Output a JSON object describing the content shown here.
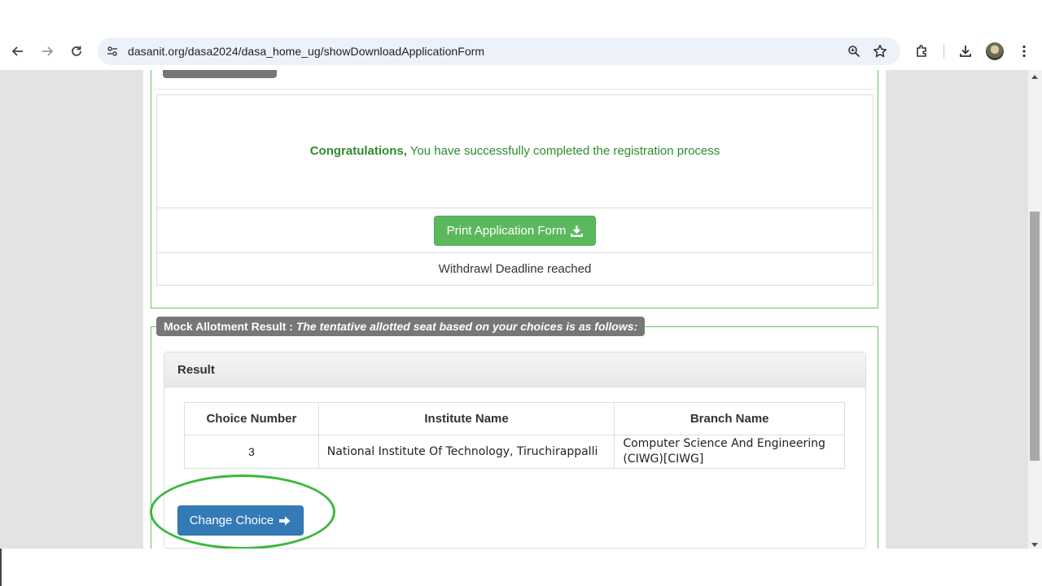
{
  "browser": {
    "url": "dasanit.org/dasa2024/dasa_home_ug/showDownloadApplicationForm",
    "icons": [
      "back-arrow-icon",
      "forward-arrow-icon",
      "reload-icon",
      "site-settings-icon",
      "zoom-icon",
      "bookmark-star-icon",
      "extensions-icon",
      "download-icon",
      "profile-avatar",
      "menu-dots-icon"
    ]
  },
  "application_section": {
    "congrats_bold": "Congratulations,",
    "congrats_text": " You have successfully completed the registration process",
    "print_button": "Print Application Form",
    "withdraw_text": "Withdrawl Deadline reached"
  },
  "mock_allotment": {
    "legend_bold": "Mock Allotment Result :",
    "legend_italic": "The tentative allotted seat based on your choices is as follows:",
    "panel_title": "Result",
    "table": {
      "headers": [
        "Choice Number",
        "Institute Name",
        "Branch Name"
      ],
      "rows": [
        [
          "3",
          "National Institute Of Technology, Tiruchirappalli",
          "Computer Science And Engineering (CIWG)[CIWG]"
        ]
      ]
    },
    "change_button": "Change Choice"
  },
  "colors": {
    "success_green": "#5cb85c",
    "primary_blue": "#337ab7",
    "congrats_green": "#2e8b2e",
    "highlight_green": "#3cb83c"
  }
}
